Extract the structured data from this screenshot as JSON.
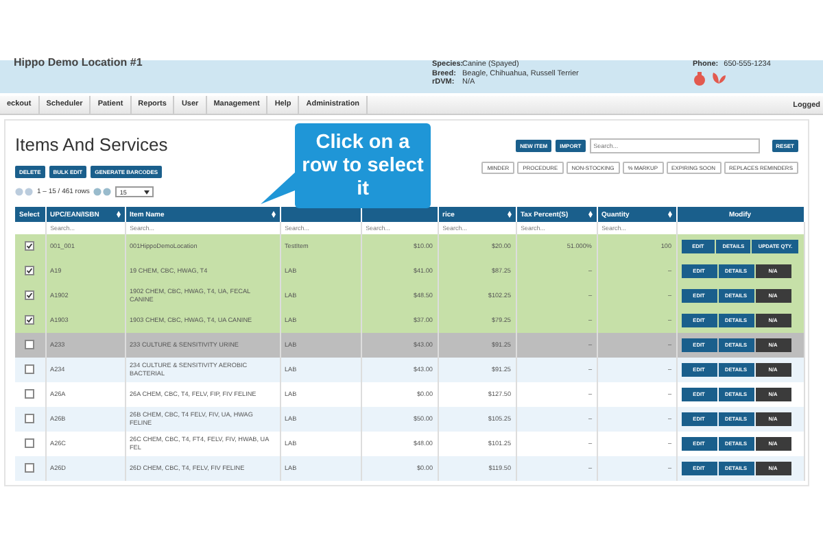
{
  "header": {
    "location": "Hippo Demo Location #1",
    "patient_fields": [
      {
        "label": "Species:",
        "value": "Canine (Spayed)"
      },
      {
        "label": "Breed:",
        "value": "Beagle, Chihuahua, Russell Terrier"
      },
      {
        "label": "rDVM:",
        "value": "N/A"
      }
    ],
    "phone": {
      "label": "Phone:",
      "value": "650-555-1234"
    }
  },
  "nav": {
    "items": [
      {
        "label": "eckout"
      },
      {
        "label": "Scheduler"
      },
      {
        "label": "Patient"
      },
      {
        "label": "Reports"
      },
      {
        "label": "User"
      },
      {
        "label": "Management"
      },
      {
        "label": "Help"
      },
      {
        "label": "Administration"
      }
    ],
    "right": "Logged"
  },
  "page": {
    "title": "Items And Services",
    "actions": [
      "DELETE",
      "BULK EDIT",
      "GENERATE BARCODES"
    ],
    "top_buttons": [
      "NEW ITEM",
      "IMPORT"
    ],
    "search": {
      "placeholder": "Search..."
    },
    "reset": "RESET",
    "filters": [
      "MINDER",
      "PROCEDURE",
      "NON-STOCKING",
      "% MARKUP",
      "EXPIRING SOON",
      "REPLACES REMINDERS"
    ],
    "pager": {
      "range": "1 – 15 / 461 rows",
      "page_size": "15"
    }
  },
  "callout": {
    "text": "Click on a row to select it"
  },
  "table": {
    "select_header": "Select",
    "columns": [
      {
        "label": "UPC/EAN/ISBN",
        "sortable": true,
        "search_placeholder": "Search..."
      },
      {
        "label": "Item Name",
        "sortable": true,
        "search_placeholder": "Search..."
      },
      {
        "sortable": false,
        "search_placeholder": "Search..."
      },
      {
        "sortable": false,
        "search_placeholder": "Search..."
      },
      {
        "label": "rice",
        "sortable": true,
        "search_placeholder": "Search..."
      },
      {
        "label": "Tax Percent(S)",
        "sortable": true,
        "search_placeholder": "Search..."
      },
      {
        "label": "Quantity",
        "sortable": true,
        "search_placeholder": "Search..."
      },
      {
        "label": "Modify",
        "sortable": false
      }
    ],
    "rows": [
      {
        "checked": true,
        "hovered": false,
        "cells": [
          "001_001",
          "001HippoDemoLocation",
          "TestItem",
          "$10.00",
          "$20.00",
          "51.000%",
          "100"
        ],
        "buttons": [
          "EDIT",
          "DETAILS"
        ],
        "action": {
          "label": "UPDATE QTY.",
          "kind": "update"
        }
      },
      {
        "checked": true,
        "hovered": false,
        "cells": [
          "A19",
          "19 CHEM, CBC, HWAG, T4",
          "LAB",
          "$41.00",
          "$87.25",
          "–",
          "–"
        ],
        "buttons": [
          "EDIT",
          "DETAILS"
        ],
        "action": {
          "label": "N/A",
          "kind": "na"
        }
      },
      {
        "checked": true,
        "hovered": false,
        "cells": [
          "A1902",
          "1902 CHEM, CBC, HWAG, T4, UA, FECAL CANINE",
          "LAB",
          "$48.50",
          "$102.25",
          "–",
          "–"
        ],
        "buttons": [
          "EDIT",
          "DETAILS"
        ],
        "action": {
          "label": "N/A",
          "kind": "na"
        }
      },
      {
        "checked": true,
        "hovered": false,
        "cells": [
          "A1903",
          "1903 CHEM, CBC, HWAG, T4, UA CANINE",
          "LAB",
          "$37.00",
          "$79.25",
          "–",
          "–"
        ],
        "buttons": [
          "EDIT",
          "DETAILS"
        ],
        "action": {
          "label": "N/A",
          "kind": "na"
        }
      },
      {
        "checked": false,
        "hovered": true,
        "cells": [
          "A233",
          "233 CULTURE & SENSITIVITY URINE",
          "LAB",
          "$43.00",
          "$91.25",
          "–",
          "–"
        ],
        "buttons": [
          "EDIT",
          "DETAILS"
        ],
        "action": {
          "label": "N/A",
          "kind": "na"
        }
      },
      {
        "checked": false,
        "hovered": false,
        "cells": [
          "A234",
          "234 CULTURE & SENSITIVITY AEROBIC BACTERIAL",
          "LAB",
          "$43.00",
          "$91.25",
          "–",
          "–"
        ],
        "buttons": [
          "EDIT",
          "DETAILS"
        ],
        "action": {
          "label": "N/A",
          "kind": "na"
        }
      },
      {
        "checked": false,
        "hovered": false,
        "cells": [
          "A26A",
          "26A CHEM, CBC, T4, FELV, FIP, FIV FELINE",
          "LAB",
          "$0.00",
          "$127.50",
          "–",
          "–"
        ],
        "buttons": [
          "EDIT",
          "DETAILS"
        ],
        "action": {
          "label": "N/A",
          "kind": "na"
        }
      },
      {
        "checked": false,
        "hovered": false,
        "cells": [
          "A26B",
          "26B CHEM, CBC, T4 FELV, FIV, UA, HWAG FELINE",
          "LAB",
          "$50.00",
          "$105.25",
          "–",
          "–"
        ],
        "buttons": [
          "EDIT",
          "DETAILS"
        ],
        "action": {
          "label": "N/A",
          "kind": "na"
        }
      },
      {
        "checked": false,
        "hovered": false,
        "cells": [
          "A26C",
          "26C CHEM, CBC, T4, FT4, FELV, FIV, HWAB, UA FEL",
          "LAB",
          "$48.00",
          "$101.25",
          "–",
          "–"
        ],
        "buttons": [
          "EDIT",
          "DETAILS"
        ],
        "action": {
          "label": "N/A",
          "kind": "na"
        }
      },
      {
        "checked": false,
        "hovered": false,
        "cells": [
          "A26D",
          "26D CHEM, CBC, T4, FELV, FIV FELINE",
          "LAB",
          "$0.00",
          "$119.50",
          "–",
          "–"
        ],
        "buttons": [
          "EDIT",
          "DETAILS"
        ],
        "action": {
          "label": "N/A",
          "kind": "na"
        }
      }
    ]
  }
}
